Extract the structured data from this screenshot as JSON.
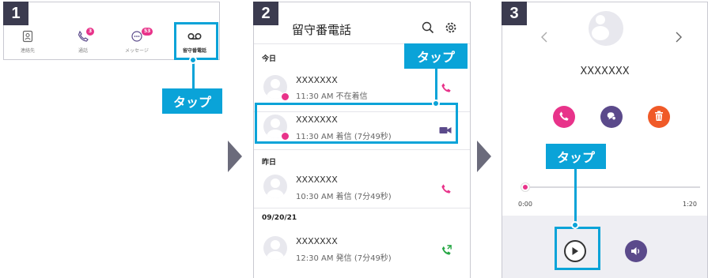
{
  "steps": [
    "1",
    "2",
    "3"
  ],
  "tap_label": "タップ",
  "panel1": {
    "nav": [
      {
        "label": "連絡先",
        "icon": "contacts-icon"
      },
      {
        "label": "通話",
        "icon": "phone-icon",
        "badge": "3"
      },
      {
        "label": "メッセージ",
        "icon": "message-icon",
        "badge": "53"
      },
      {
        "label": "留守番電話",
        "icon": "voicemail-icon"
      }
    ]
  },
  "panel2": {
    "title": "留守番電話",
    "sections": {
      "today": "今日",
      "yesterday": "昨日",
      "date": "09/20/21"
    },
    "entries": [
      {
        "name": "XXXXXXX",
        "meta": "11:30 AM  不在着信",
        "icon": "phone-icon"
      },
      {
        "name": "XXXXXXX",
        "meta": "11:30 AM  着信 (7分49秒)",
        "icon": "video-icon"
      },
      {
        "name": "XXXXXXX",
        "meta": "10:30 AM  着信 (7分49秒)",
        "icon": "phone-icon"
      },
      {
        "name": "XXXXXXX",
        "meta": "12:30 AM  発信 (7分49秒)",
        "icon": "outgoing-call-icon"
      }
    ]
  },
  "panel3": {
    "name": "XXXXXXX",
    "time_start": "0:00",
    "time_end": "1:20",
    "progress": 0.02
  },
  "colors": {
    "accent": "#0aa3d8",
    "pink": "#e8338a",
    "purple": "#5b4a8b",
    "orange": "#f05a28",
    "green": "#27a745"
  }
}
